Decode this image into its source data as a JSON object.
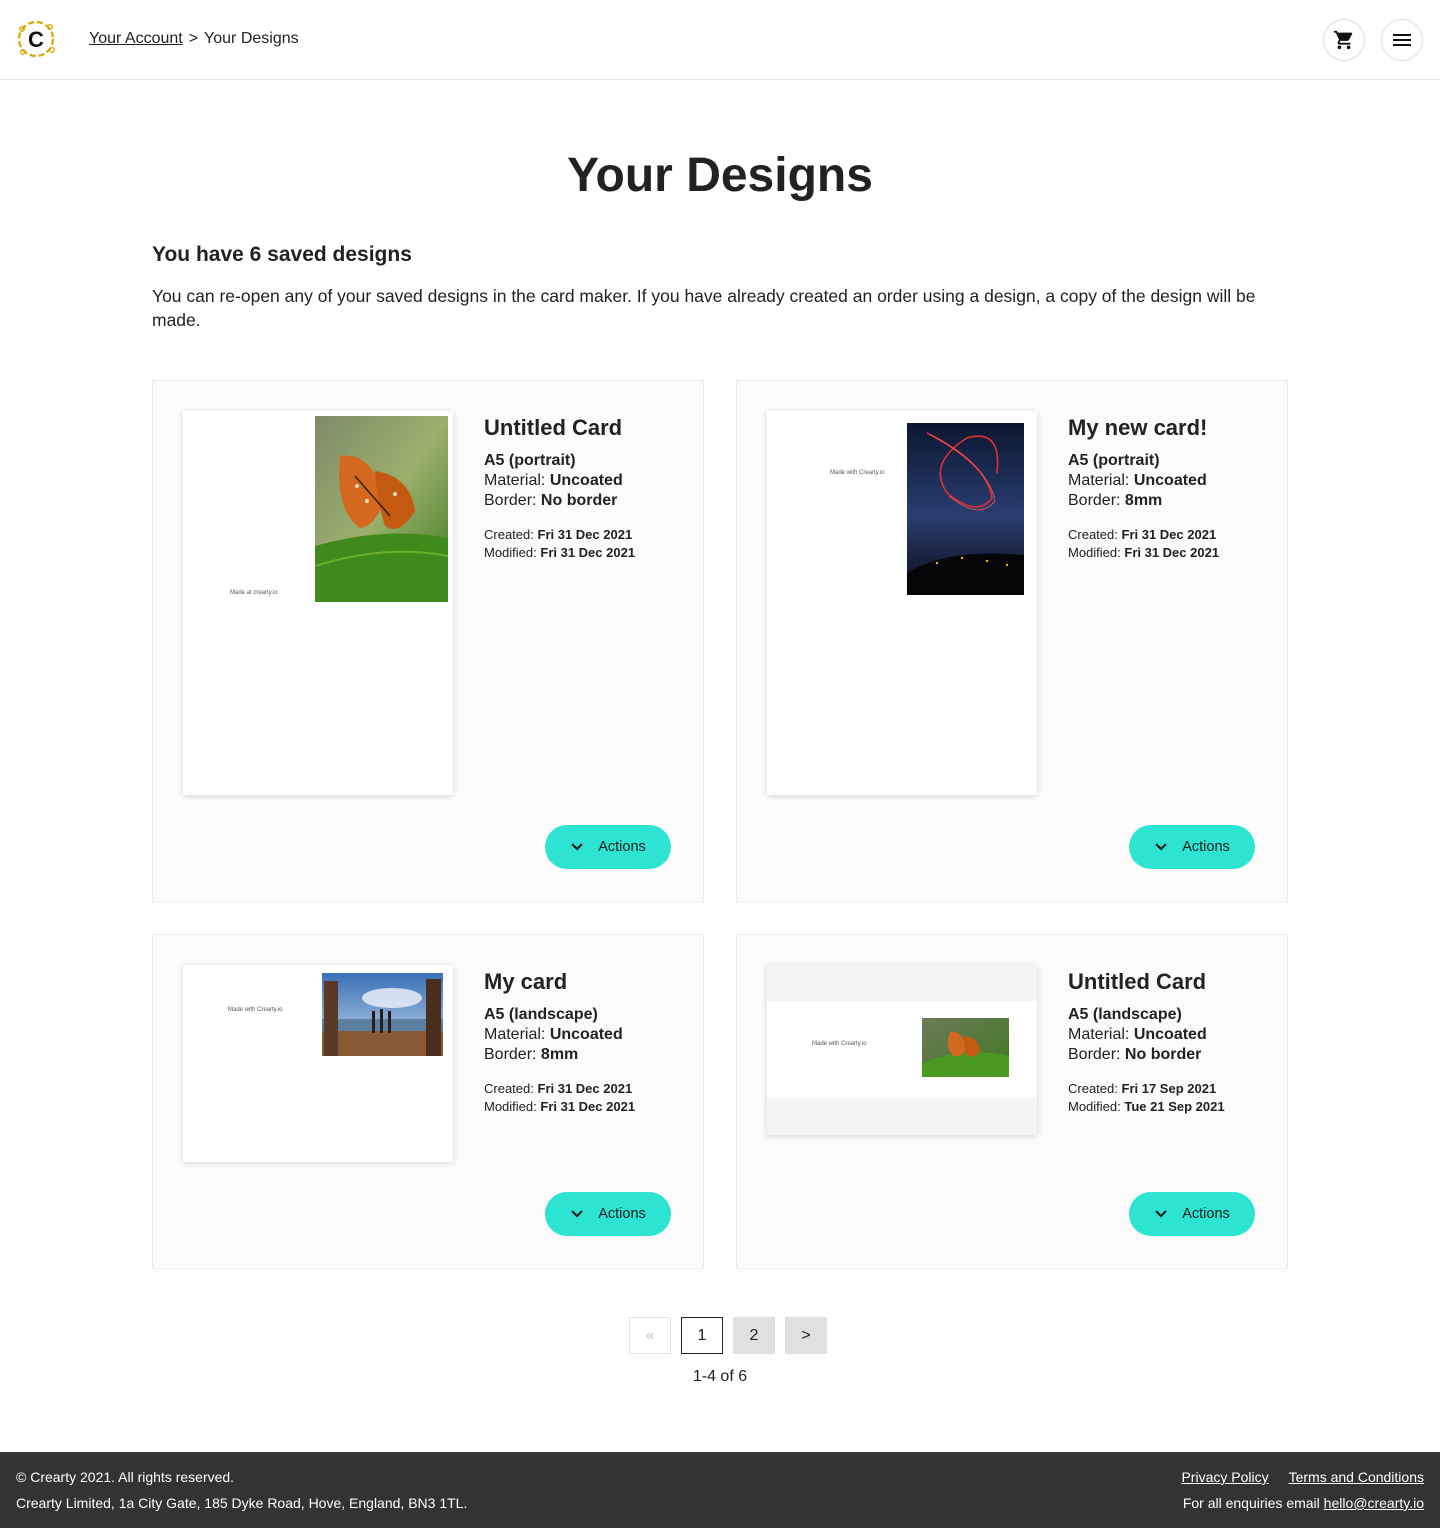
{
  "header": {
    "breadcrumb": {
      "link": "Your Account",
      "separator": ">",
      "current": "Your Designs"
    },
    "logo_letter": "C"
  },
  "main": {
    "title": "Your Designs",
    "subheading": "You have 6 saved designs",
    "intro": "You can re-open any of your saved designs in the card maker. If you have already created an order using a design, a copy of the design will be made."
  },
  "labels": {
    "material": "Material:",
    "border": "Border:",
    "created": "Created:",
    "modified": "Modified:",
    "actions": "Actions"
  },
  "designs": [
    {
      "name": "Untitled Card",
      "format": "A5 (portrait)",
      "material": "Uncoated",
      "border": "No border",
      "created": "Fri 31 Dec 2021",
      "modified": "Fri 31 Dec 2021",
      "preview_text": "Made at crearty.io"
    },
    {
      "name": "My new card!",
      "format": "A5 (portrait)",
      "material": "Uncoated",
      "border": "8mm",
      "created": "Fri 31 Dec 2021",
      "modified": "Fri 31 Dec 2021",
      "preview_text": "Made with Crearty.io"
    },
    {
      "name": "My card",
      "format": "A5 (landscape)",
      "material": "Uncoated",
      "border": "8mm",
      "created": "Fri 31 Dec 2021",
      "modified": "Fri 31 Dec 2021",
      "preview_text": "Made with Crearty.io"
    },
    {
      "name": "Untitled Card",
      "format": "A5 (landscape)",
      "material": "Uncoated",
      "border": "No border",
      "created": "Fri 17 Sep 2021",
      "modified": "Tue 21 Sep 2021",
      "preview_text": "Made with Crearty.io"
    }
  ],
  "pagination": {
    "prev": "«",
    "pages": [
      "1",
      "2"
    ],
    "current": "1",
    "next": ">",
    "range": "1-4 of 6"
  },
  "footer": {
    "copyright": "© Crearty 2021. All rights reserved.",
    "address": "Crearty Limited, 1a City Gate, 185 Dyke Road, Hove, England, BN3 1TL.",
    "privacy": "Privacy Policy",
    "terms": "Terms and Conditions",
    "enquiries": "For all enquiries email",
    "email": "hello@crearty.io"
  },
  "colors": {
    "accent": "#2de3d1",
    "footer_bg": "#333333",
    "logo_ring": "#d9a400"
  },
  "icons": [
    "crearty-logo-icon",
    "cart-icon",
    "menu-icon",
    "chevron-down-icon"
  ]
}
